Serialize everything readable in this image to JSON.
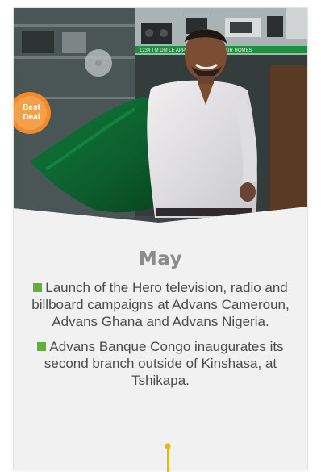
{
  "photo": {
    "description_icon": "photo-icon",
    "badge_line1": "Best",
    "badge_line2": "Deal",
    "store_banner": "1234 TM DM          LE APPLIANCES FOR YOUR HOMES"
  },
  "month": "May",
  "items": [
    "Launch of the Hero television, radio and billboard campaigns at Advans Cameroun, Advans Ghana and Advans Nigeria.",
    "Advans Banque Congo inaugurates its second branch outside of Kinshasa, at Tshikapa."
  ],
  "colors": {
    "bullet": "#5fb233",
    "timeline": "#e8b800",
    "month": "#8c8c8c"
  }
}
